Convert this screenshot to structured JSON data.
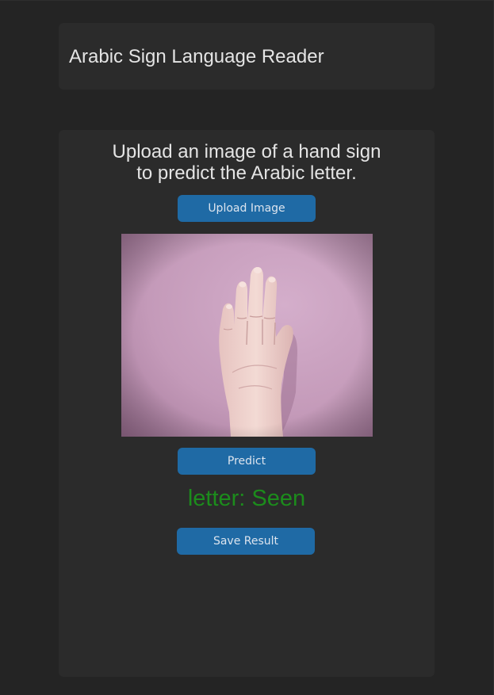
{
  "header": {
    "title": "Arabic Sign Language Reader"
  },
  "main": {
    "instruction_line1": "Upload an image of a hand sign",
    "instruction_line2": "to predict the Arabic letter.",
    "upload_label": "Upload Image",
    "predict_label": "Predict",
    "result_text": "letter: Seen",
    "save_label": "Save Result"
  },
  "colors": {
    "background": "#242424",
    "card": "#2b2b2b",
    "button": "#1f6aa5",
    "result_text": "#1c8c1c"
  }
}
